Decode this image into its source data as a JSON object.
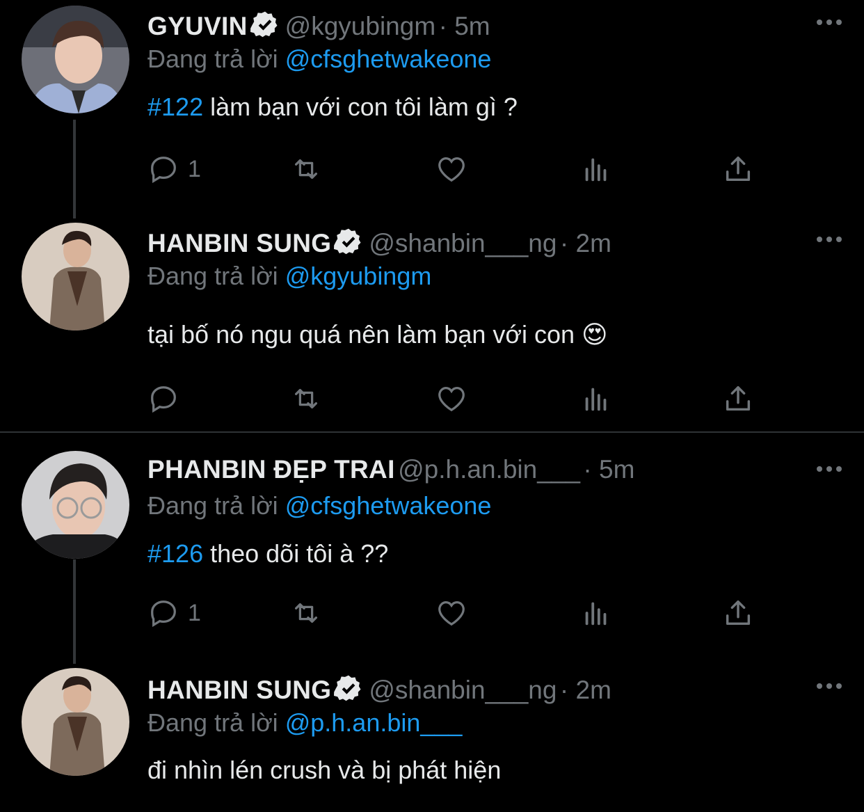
{
  "colors": {
    "background": "#000000",
    "text": "#e7e9ea",
    "muted": "#71767b",
    "accent": "#1d9bf0",
    "divider": "#2f3336"
  },
  "tweets": [
    {
      "name": "GYUVIN",
      "verified": true,
      "handle": "@kgyubingm",
      "time": "· 5m",
      "replying_label": "Đang trả lời",
      "replying_to": "@cfsghetwakeone",
      "hashtag": "#122",
      "text": " làm bạn với con tôi làm gì ?",
      "reply_count": "1"
    },
    {
      "name": "HANBIN SUNG",
      "verified": true,
      "handle": "@shanbin___ng",
      "time": "· 2m",
      "replying_label": "Đang trả lời",
      "replying_to": "@kgyubingm",
      "hashtag": "",
      "text": "tại bố nó ngu quá nên làm bạn với con 😍",
      "reply_count": ""
    },
    {
      "name": "PHANBIN ĐẸP TRAI",
      "verified": false,
      "handle": "@p.h.an.bin___",
      "time": "· 5m",
      "replying_label": "Đang trả lời",
      "replying_to": "@cfsghetwakeone",
      "hashtag": "#126",
      "text": " theo dõi tôi à ??",
      "reply_count": "1"
    },
    {
      "name": "HANBIN SUNG",
      "verified": true,
      "handle": "@shanbin___ng",
      "time": "· 2m",
      "replying_label": "Đang trả lời",
      "replying_to": "@p.h.an.bin___",
      "hashtag": "",
      "text": "đi nhìn lén crush và bị phát hiện",
      "reply_count": ""
    }
  ],
  "icons": {
    "reply": "reply-icon",
    "retweet": "retweet-icon",
    "like": "heart-icon",
    "views": "analytics-icon",
    "share": "share-icon",
    "more": "more-icon",
    "verified": "verified-badge-icon"
  }
}
